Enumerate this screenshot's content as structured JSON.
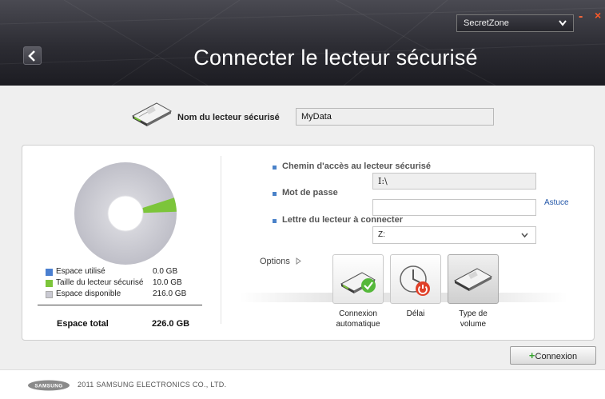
{
  "header": {
    "title": "Connecter le lecteur sécurisé",
    "back_icon": "chevron-left-icon",
    "app_select_value": "SecretZone",
    "minimize_label": "-",
    "close_label": "×"
  },
  "drive": {
    "name_label": "Nom du lecteur sécurisé",
    "name_value": "MyData"
  },
  "usage": {
    "legend": [
      {
        "label": "Espace utilisé",
        "value": "0.0 GB",
        "color": "#4a7fd0"
      },
      {
        "label": "Taille du lecteur sécurisé",
        "value": "10.0 GB",
        "color": "#7cc53a"
      },
      {
        "label": "Espace disponible",
        "value": "216.0 GB",
        "color": "#c9c9d2"
      }
    ],
    "total_label": "Espace total",
    "total_value": "226.0 GB",
    "secure_fraction": 0.0442
  },
  "form": {
    "path_label": "Chemin d'accès au lecteur sécurisé",
    "path_value": "I:\\",
    "password_label": "Mot de passe",
    "hint_link": "Astuce",
    "letter_label": "Lettre du lecteur à connecter",
    "letter_value": "Z:"
  },
  "options": {
    "label": "Options",
    "expand_icon": "triangle-right-icon",
    "tiles": [
      {
        "line1": "Connexion",
        "line2": "automatique",
        "icon": "drive-check-icon"
      },
      {
        "line1": "Délai",
        "line2": "",
        "icon": "clock-power-icon"
      },
      {
        "line1": "Type de",
        "line2": "volume",
        "icon": "drive-type-icon"
      }
    ]
  },
  "actions": {
    "connect_plus": "+",
    "connect_label": "Connexion"
  },
  "footer": {
    "logo_text": "SAMSUNG",
    "copyright": "2011 SAMSUNG ELECTRONICS CO., LTD."
  },
  "colors": {
    "accent_blue": "#4a82c9",
    "secure_green": "#7cc53a",
    "close_orange": "#ff5a28"
  }
}
